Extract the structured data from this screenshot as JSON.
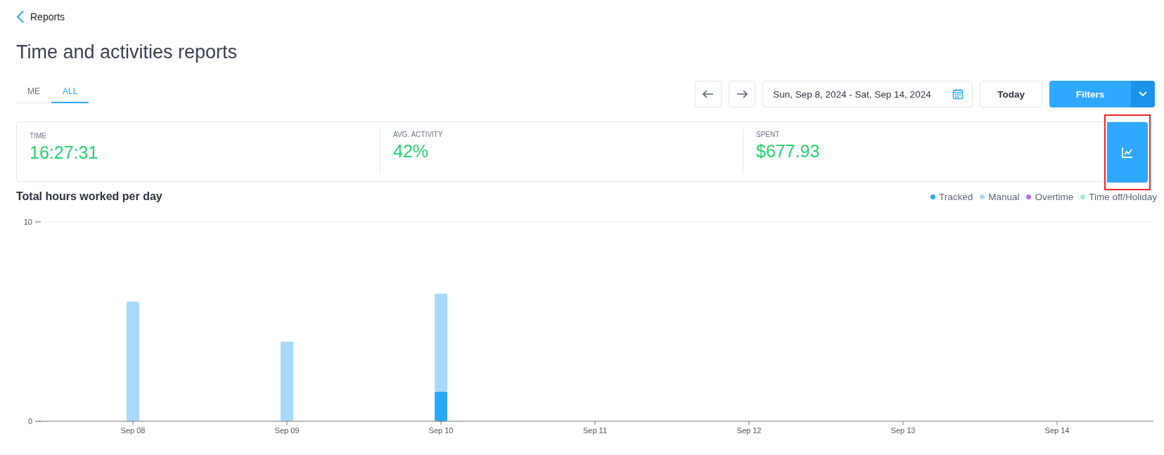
{
  "back_link": {
    "label": "Reports"
  },
  "title": "Time and activities reports",
  "tabs": [
    {
      "label": "ME",
      "selected": false
    },
    {
      "label": "ALL",
      "selected": true
    }
  ],
  "toolbar": {
    "date_range": "Sun, Sep 8, 2024 - Sat, Sep 14, 2024",
    "today_button": "Today",
    "filters_button": "Filters"
  },
  "stats": [
    {
      "label": "TIME",
      "value": "16:27:31"
    },
    {
      "label": "AVG. ACTIVITY",
      "value": "42%"
    },
    {
      "label": "SPENT",
      "value": "$677.93"
    }
  ],
  "chart_toggle": {
    "highlighted": true
  },
  "chart": {
    "title": "Total hours worked per day",
    "chart_data": {
      "type": "bar",
      "stacked": true,
      "categories": [
        "Sep 08",
        "Sep 09",
        "Sep 10",
        "Sep 11",
        "Sep 12",
        "Sep 13",
        "Sep 14"
      ],
      "ylim": [
        0,
        10
      ],
      "yticks": [
        0,
        10
      ],
      "series": [
        {
          "name": "Tracked",
          "color": "#29a8ff",
          "values": [
            0,
            0,
            1.5,
            0,
            0,
            0,
            0
          ]
        },
        {
          "name": "Manual",
          "color": "#a8d9fb",
          "values": [
            6,
            4,
            4.9,
            0,
            0,
            0,
            0
          ]
        },
        {
          "name": "Overtime",
          "color": "#b16ef0",
          "values": [
            0,
            0,
            0,
            0,
            0,
            0,
            0
          ]
        },
        {
          "name": "Time off/Holiday",
          "color": "#a6e6cd",
          "values": [
            0,
            0,
            0,
            0,
            0,
            0,
            0
          ]
        }
      ]
    }
  }
}
